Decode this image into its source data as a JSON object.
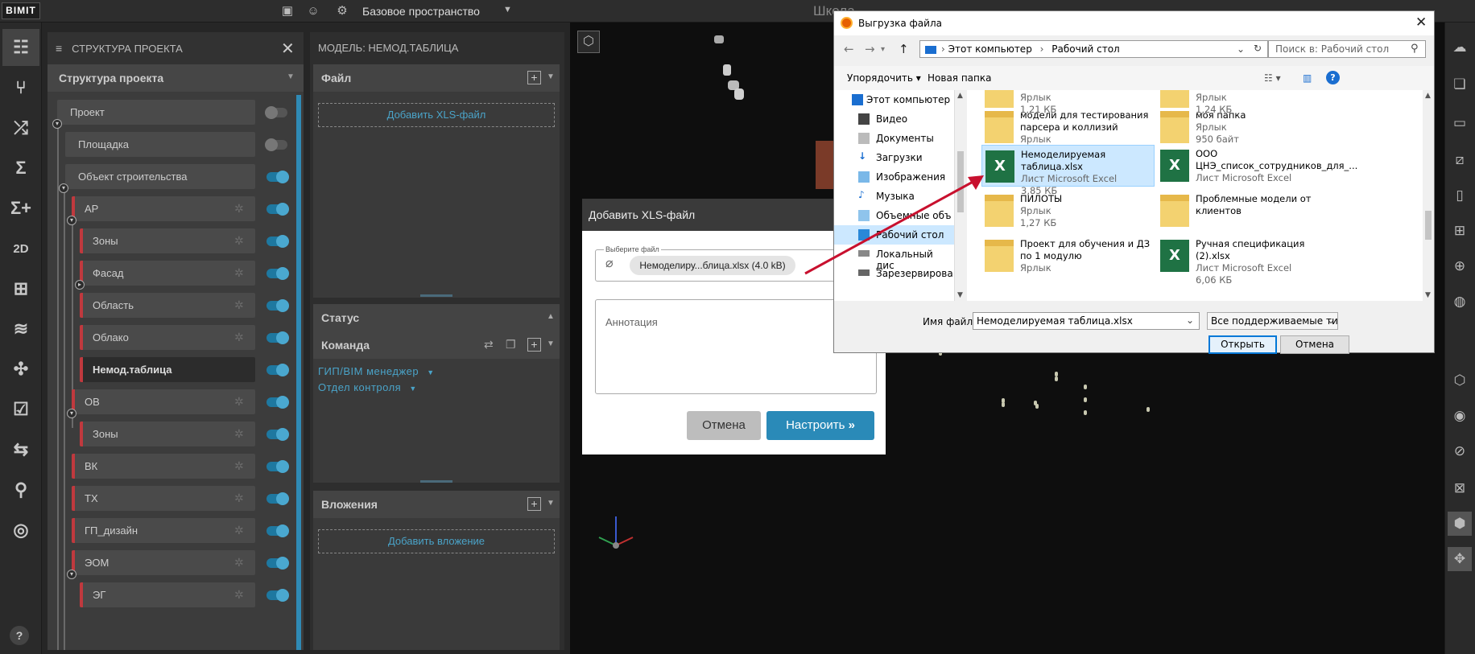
{
  "topbar": {
    "logo": "BIMIT",
    "space": "Базовое пространство",
    "school": "Школа"
  },
  "tree": {
    "title": "СТРУКТУРА ПРОЕКТА",
    "subheader": "Структура проекта",
    "nodes": [
      {
        "label": "Проект"
      },
      {
        "label": "Площадка"
      },
      {
        "label": "Объект строительства"
      },
      {
        "label": "АР"
      },
      {
        "label": "Зоны"
      },
      {
        "label": "Фасад"
      },
      {
        "label": "Область"
      },
      {
        "label": "Облако"
      },
      {
        "label": "Немод.таблица"
      },
      {
        "label": "ОВ"
      },
      {
        "label": "Зоны"
      },
      {
        "label": "ВК"
      },
      {
        "label": "ТХ"
      },
      {
        "label": "ГП_дизайн"
      },
      {
        "label": "ЭОМ"
      },
      {
        "label": "ЭГ"
      }
    ]
  },
  "model": {
    "title": "МОДЕЛЬ: НЕМОД.ТАБЛИЦА",
    "file_header": "Файл",
    "add_xls": "Добавить XLS-файл",
    "status_header": "Статус",
    "team_header": "Команда",
    "roles": [
      "ГИП/BIM менеджер",
      "Отдел контроля"
    ],
    "attach_header": "Вложения",
    "add_attach": "Добавить вложение"
  },
  "xls_dialog": {
    "title": "Добавить XLS-файл",
    "file_label": "Выберите файл",
    "file_chip": "Немоделиру...блица.xlsx (4.0 kB)",
    "annotation_placeholder": "Аннотация",
    "cancel": "Отмена",
    "setup": "Настроить"
  },
  "file_dialog": {
    "title": "Выгрузка файла",
    "path": [
      "Этот компьютер",
      "Рабочий стол"
    ],
    "search_placeholder": "Поиск в: Рабочий стол",
    "organize": "Упорядочить",
    "new_folder": "Новая папка",
    "nav": [
      "Этот компьютер",
      "Видео",
      "Документы",
      "Загрузки",
      "Изображения",
      "Музыка",
      "Объемные объ",
      "Рабочий стол",
      "Локальный дис",
      "Зарезервирова"
    ],
    "files": [
      {
        "name": "",
        "type": "Ярлык",
        "size": "1,21 КБ",
        "icon": "shortcut"
      },
      {
        "name": "",
        "type": "Ярлык",
        "size": "1,24 КБ",
        "icon": "shortcut"
      },
      {
        "name": "модели для тестирования парсера и коллизий",
        "type": "Ярлык",
        "size": "",
        "icon": "folder"
      },
      {
        "name": "моя папка",
        "type": "Ярлык",
        "size": "950 байт",
        "icon": "folder"
      },
      {
        "name": "Немоделируемая таблица.xlsx",
        "type": "Лист Microsoft Excel",
        "size": "3,85 КБ",
        "icon": "excel"
      },
      {
        "name": "ООО ЦНЭ_список_сотрудников_для_...",
        "type": "Лист Microsoft Excel",
        "size": "",
        "icon": "excel"
      },
      {
        "name": "ПИЛОТЫ",
        "type": "Ярлык",
        "size": "1,27 КБ",
        "icon": "folder"
      },
      {
        "name": "Проблемные модели от клиентов",
        "type": "",
        "size": "",
        "icon": "folder"
      },
      {
        "name": "Проект для обучения и ДЗ по 1 модулю",
        "type": "Ярлык",
        "size": "",
        "icon": "folder"
      },
      {
        "name": "Ручная спецификация (2).xlsx",
        "type": "Лист Microsoft Excel",
        "size": "6,06 КБ",
        "icon": "excel"
      }
    ],
    "filename_label": "Имя файла:",
    "filename": "Немоделируемая таблица.xlsx",
    "filetype": "Все поддерживаемые типы (*.",
    "open": "Открыть",
    "cancel": "Отмена"
  },
  "colors": {
    "accent": "#2a8ab8",
    "node_mark": "#c0393e",
    "selection": "#cce8ff",
    "arrow": "#c8102e"
  },
  "help": "?"
}
